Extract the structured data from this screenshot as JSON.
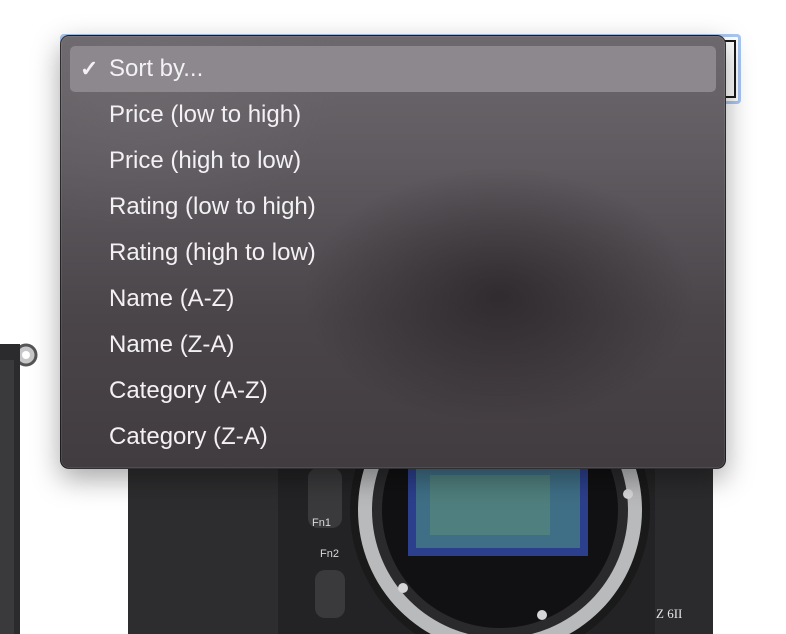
{
  "sort_select": {
    "selected_value": "Sort by...",
    "options": [
      {
        "label": "Sort by...",
        "selected": true
      },
      {
        "label": "Price (low to high)",
        "selected": false
      },
      {
        "label": "Price (high to low)",
        "selected": false
      },
      {
        "label": "Rating (low to high)",
        "selected": false
      },
      {
        "label": "Rating (high to low)",
        "selected": false
      },
      {
        "label": "Name (A-Z)",
        "selected": false
      },
      {
        "label": "Name (Z-A)",
        "selected": false
      },
      {
        "label": "Category (A-Z)",
        "selected": false
      },
      {
        "label": "Category (Z-A)",
        "selected": false
      }
    ],
    "checkmark_icon": "checkmark-icon",
    "checkmark_glyph": "✓"
  },
  "camera_image": {
    "button_labels": [
      "Fn1",
      "Fn2"
    ],
    "model_badge": "Z 6II"
  },
  "colors": {
    "menu_background": "#5a5559",
    "selected_highlight": "#8c888d",
    "menu_text": "#f3f1f4",
    "focus_ring": "#a9c7f2"
  }
}
